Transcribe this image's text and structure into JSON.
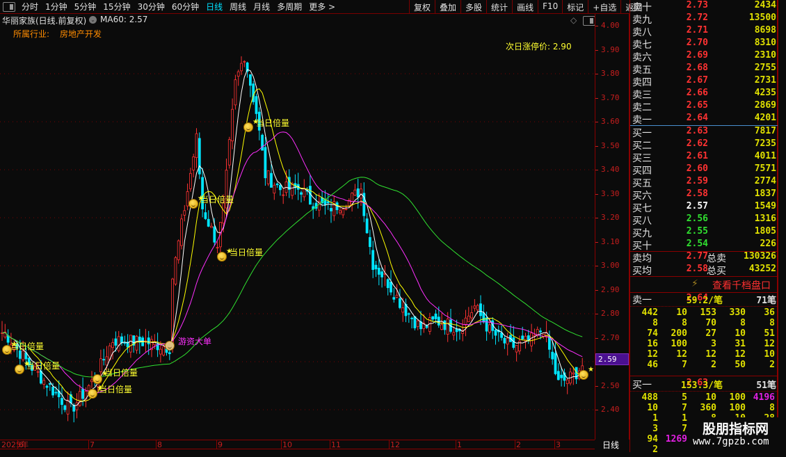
{
  "toolbar": {
    "periods": [
      "分时",
      "1分钟",
      "5分钟",
      "15分钟",
      "30分钟",
      "60分钟",
      "日线",
      "周线",
      "月线",
      "多周期",
      "更多 >"
    ],
    "active_period": "日线",
    "buttons": [
      "复权",
      "叠加",
      "多股",
      "统计",
      "画线",
      "F10",
      "标记",
      "+自选",
      "返回"
    ]
  },
  "header": {
    "title": "华丽家族(日线.前复权)",
    "ma_label": "MA60: 2.57",
    "industry_label": "所属行业:",
    "industry_value": "房地产开发",
    "limit_up_label": "次日涨停价: 2.90"
  },
  "signals": {
    "double_volume": "当日倍量",
    "hot_money": "游资大单"
  },
  "colors": {
    "up": "#ff3232",
    "down": "#00e5ff",
    "ma5": "#ffffff",
    "ma10": "#ffff00",
    "ma20": "#ff30ff",
    "ma60": "#30e030",
    "accent": "#00e0ff"
  },
  "price_axis": {
    "labels": [
      "4.00",
      "3.90",
      "3.80",
      "3.70",
      "3.60",
      "3.50",
      "3.40",
      "3.30",
      "3.20",
      "3.10",
      "3.00",
      "2.90",
      "2.80",
      "2.70",
      "2.60",
      "2.50",
      "2.40"
    ],
    "current": "2.59"
  },
  "date_axis": {
    "labels": [
      "2025年",
      "6",
      "7",
      "8",
      "9",
      "10",
      "11",
      "12",
      "1",
      "2",
      "3"
    ],
    "period_label": "日线"
  },
  "chart_data": {
    "type": "candlestick",
    "ylim": [
      2.37,
      4.03
    ],
    "approx_close_path": [
      {
        "bar": 1,
        "close": 2.72
      },
      {
        "bar": 9,
        "close": 2.59
      },
      {
        "bar": 23,
        "close": 2.4
      },
      {
        "bar": 31,
        "close": 2.53
      },
      {
        "bar": 37,
        "close": 2.69
      },
      {
        "bar": 49,
        "close": 2.68
      },
      {
        "bar": 56,
        "close": 2.66
      },
      {
        "bar": 57,
        "close": 2.95
      },
      {
        "bar": 65,
        "close": 3.53
      },
      {
        "bar": 67,
        "close": 3.24
      },
      {
        "bar": 72,
        "close": 3.09
      },
      {
        "bar": 74,
        "close": 3.24
      },
      {
        "bar": 78,
        "close": 3.76
      },
      {
        "bar": 81,
        "close": 3.88
      },
      {
        "bar": 85,
        "close": 3.64
      },
      {
        "bar": 88,
        "close": 3.38
      },
      {
        "bar": 93,
        "close": 3.32
      },
      {
        "bar": 100,
        "close": 3.32
      },
      {
        "bar": 103,
        "close": 3.27
      },
      {
        "bar": 109,
        "close": 3.24
      },
      {
        "bar": 116,
        "close": 3.27
      },
      {
        "bar": 120,
        "close": 3.32
      },
      {
        "bar": 122,
        "close": 3.15
      },
      {
        "bar": 124,
        "close": 3.01
      },
      {
        "bar": 128,
        "close": 2.95
      },
      {
        "bar": 134,
        "close": 2.83
      },
      {
        "bar": 140,
        "close": 2.74
      },
      {
        "bar": 145,
        "close": 2.77
      },
      {
        "bar": 153,
        "close": 2.74
      },
      {
        "bar": 158,
        "close": 2.83
      },
      {
        "bar": 163,
        "close": 2.73
      },
      {
        "bar": 170,
        "close": 2.66
      },
      {
        "bar": 177,
        "close": 2.69
      },
      {
        "bar": 181,
        "close": 2.74
      },
      {
        "bar": 186,
        "close": 2.51
      },
      {
        "bar": 191,
        "close": 2.54
      },
      {
        "bar": 195,
        "close": 2.6
      }
    ],
    "moving_averages": [
      "MA5",
      "MA10",
      "MA20",
      "MA60"
    ]
  },
  "order_book": {
    "asks": [
      {
        "label": "卖十",
        "price": "2.73",
        "vol": "2434",
        "color": "#ff3232"
      },
      {
        "label": "卖九",
        "price": "2.72",
        "vol": "13500",
        "color": "#ff3232"
      },
      {
        "label": "卖八",
        "price": "2.71",
        "vol": "8698",
        "color": "#ff3232"
      },
      {
        "label": "卖七",
        "price": "2.70",
        "vol": "8310",
        "color": "#ff3232"
      },
      {
        "label": "卖六",
        "price": "2.69",
        "vol": "2310",
        "color": "#ff3232"
      },
      {
        "label": "卖五",
        "price": "2.68",
        "vol": "2755",
        "color": "#ff3232"
      },
      {
        "label": "卖四",
        "price": "2.67",
        "vol": "2731",
        "color": "#ff3232"
      },
      {
        "label": "卖三",
        "price": "2.66",
        "vol": "4235",
        "color": "#ff3232"
      },
      {
        "label": "卖二",
        "price": "2.65",
        "vol": "2869",
        "color": "#ff3232"
      },
      {
        "label": "卖一",
        "price": "2.64",
        "vol": "4201",
        "color": "#ff3232"
      }
    ],
    "bids": [
      {
        "label": "买一",
        "price": "2.63",
        "vol": "7817",
        "color": "#ff3232"
      },
      {
        "label": "买二",
        "price": "2.62",
        "vol": "7235",
        "color": "#ff3232"
      },
      {
        "label": "买三",
        "price": "2.61",
        "vol": "4011",
        "color": "#ff3232"
      },
      {
        "label": "买四",
        "price": "2.60",
        "vol": "7571",
        "color": "#ff3232"
      },
      {
        "label": "买五",
        "price": "2.59",
        "vol": "2774",
        "color": "#ff3232"
      },
      {
        "label": "买六",
        "price": "2.58",
        "vol": "1837",
        "color": "#ff3232"
      },
      {
        "label": "买七",
        "price": "2.57",
        "vol": "1549",
        "color": "#ffffff"
      },
      {
        "label": "买八",
        "price": "2.56",
        "vol": "1316",
        "color": "#30e030"
      },
      {
        "label": "买九",
        "price": "2.55",
        "vol": "1805",
        "color": "#30e030"
      },
      {
        "label": "买十",
        "price": "2.54",
        "vol": "226",
        "color": "#30e030"
      }
    ],
    "summary": [
      {
        "label": "卖均",
        "price": "2.77",
        "label2": "总卖",
        "vol": "130326"
      },
      {
        "label": "买均",
        "price": "2.58",
        "label2": "总买",
        "vol": "43252"
      }
    ],
    "thousand_link": "查看千档盘口",
    "ask1_queue": {
      "label": "卖一",
      "price": "2.64",
      "avg": "59.2/笔",
      "count": "71笔",
      "rows": [
        [
          "442",
          "10",
          "153",
          "330",
          "36"
        ],
        [
          "8",
          "8",
          "70",
          "8",
          "8"
        ],
        [
          "74",
          "200",
          "27",
          "10",
          "51"
        ],
        [
          "16",
          "100",
          "3",
          "31",
          "12"
        ],
        [
          "12",
          "12",
          "12",
          "12",
          "10"
        ],
        [
          "46",
          "7",
          "2",
          "50",
          "2"
        ]
      ]
    },
    "bid1_queue": {
      "label": "买一",
      "price": "2.63",
      "avg": "153.3/笔",
      "count": "51笔",
      "rows": [
        [
          "488",
          "5",
          "10",
          "100",
          "4196"
        ],
        [
          "10",
          "7",
          "360",
          "100",
          "8"
        ],
        [
          "1",
          "1",
          "8",
          "10",
          "28"
        ],
        [
          "3",
          "7",
          "",
          "",
          ""
        ],
        [
          "94",
          "1269",
          "",
          "",
          ""
        ],
        [
          "2",
          "",
          "",
          "",
          ""
        ]
      ]
    }
  },
  "watermark": {
    "name": "股朋指标网",
    "url": "www.7gpzb.com"
  }
}
